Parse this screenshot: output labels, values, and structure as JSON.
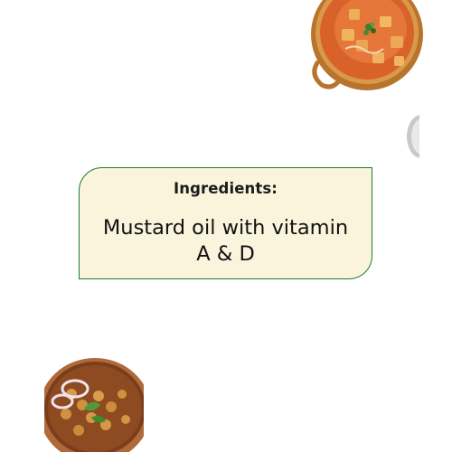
{
  "colors": {
    "background": "#ffffff",
    "card_fill": "#fbf4dc",
    "card_border": "#1f7a2c",
    "text": "#111111"
  },
  "images": {
    "top_right": "paneer-curry-bowl",
    "bottom_left": "chole-bowl"
  },
  "card": {
    "heading": "Ingredients:",
    "body_line1": "Mustard oil with vitamin",
    "body_line2": "A & D"
  }
}
